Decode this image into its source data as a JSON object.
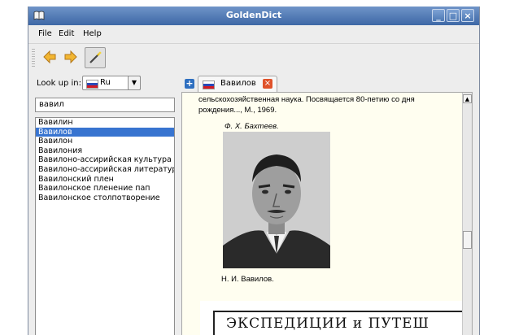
{
  "window": {
    "title": "GoldenDict",
    "controls": {
      "minimize": "_",
      "maximize": "□",
      "close": "×"
    }
  },
  "menu": {
    "file": "File",
    "edit": "Edit",
    "help": "Help"
  },
  "toolbar": {
    "icons": [
      "back-arrow-icon",
      "forward-arrow-icon",
      "magic-wand-icon"
    ]
  },
  "lookup": {
    "label": "Look up in:",
    "group": "Ru",
    "query": "вавил"
  },
  "wordlist": {
    "items": [
      "Вавилин",
      "Вавилов",
      "Вавилон",
      "Вавилония",
      "Вавилоно-ассирийская культура",
      "Вавилоно-ассирийская литература",
      "Вавилонский плен",
      "Вавилонское пленение пап",
      "Вавилонское столпотворение"
    ],
    "selected_index": 1
  },
  "tab": {
    "label": "Вавилов",
    "close": "×",
    "add": "+"
  },
  "article": {
    "lines": [
      "сельскохозяйственная наука. Посвящается 80-петию со дня",
      "рождения..., М., 1969."
    ],
    "author": "Ф. Х. Бахтеев.",
    "caption": "Н. И. Вавилов.",
    "scan_heading": "ЭКСПЕДИЦИИ и ПУТЕШ"
  },
  "colors": {
    "titlebar": "#4a73b0",
    "selection": "#3874d0",
    "article_bg": "#fffef0",
    "close_tab": "#e0522a"
  }
}
